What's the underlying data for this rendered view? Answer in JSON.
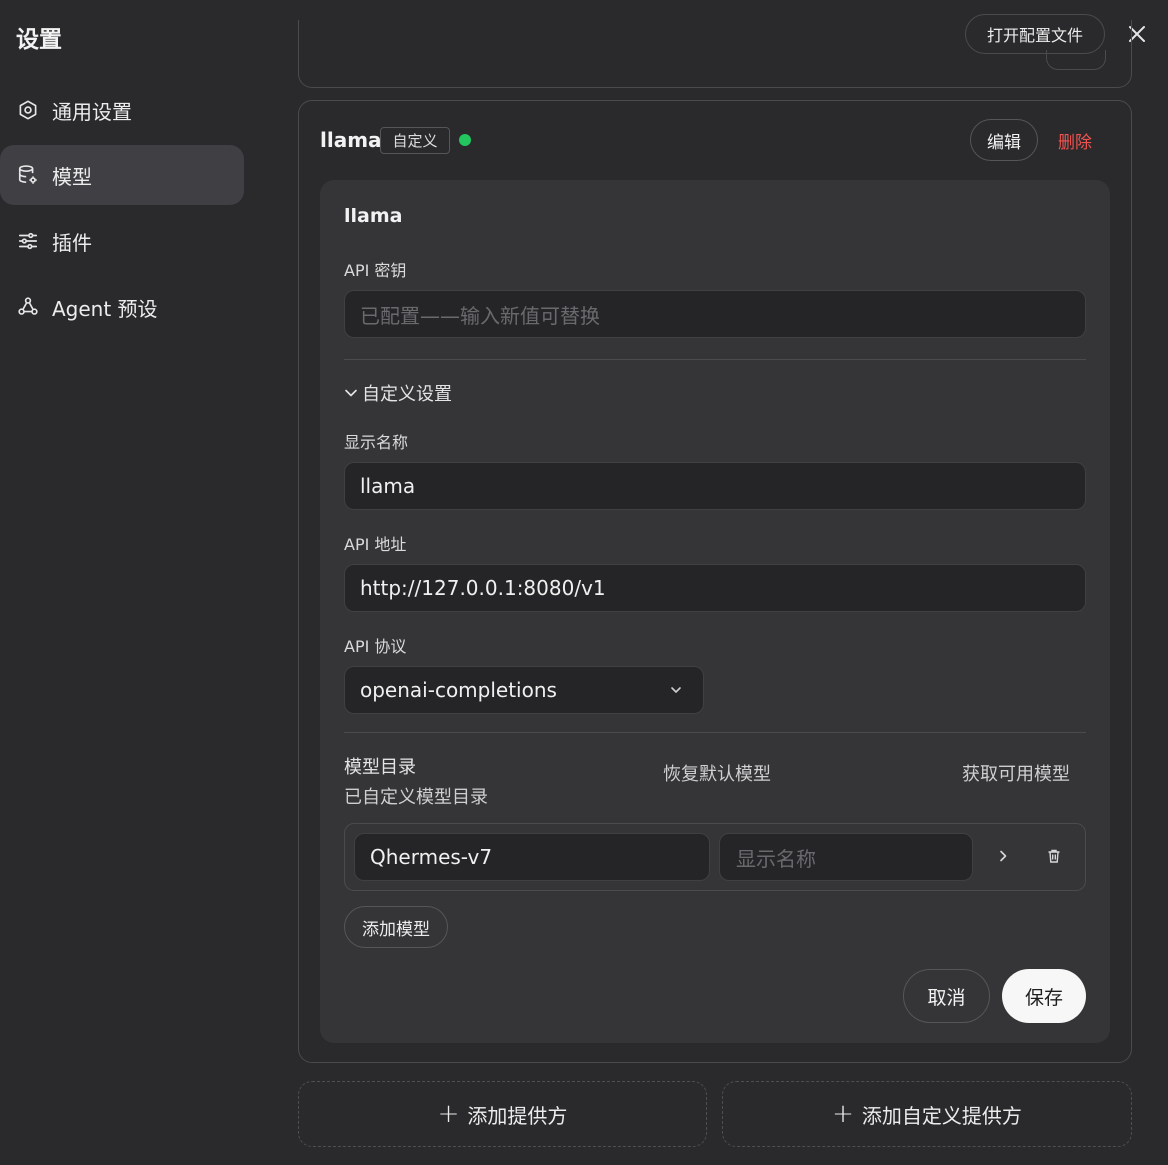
{
  "header": {
    "title": "设置",
    "open_config_label": "打开配置文件",
    "close_icon": "close-icon"
  },
  "sidebar": {
    "items": [
      {
        "label": "通用设置",
        "icon": "gear-icon",
        "active": false
      },
      {
        "label": "模型",
        "icon": "database-gear-icon",
        "active": true
      },
      {
        "label": "插件",
        "icon": "sliders-icon",
        "active": false
      },
      {
        "label": "Agent 预设",
        "icon": "agent-nodes-icon",
        "active": false
      }
    ]
  },
  "provider": {
    "name": "llama",
    "badge": "自定义",
    "status_color": "#22c55e",
    "edit_label": "编辑",
    "delete_label": "删除",
    "delete_color": "#ef5350"
  },
  "form": {
    "title": "llama",
    "api_key_label": "API 密钥",
    "api_key_placeholder": "已配置——输入新值可替换",
    "custom_settings_label": "自定义设置",
    "display_name_label": "显示名称",
    "display_name_value": "llama",
    "api_url_label": "API 地址",
    "api_url_value": "http://127.0.0.1:8080/v1",
    "api_protocol_label": "API 协议",
    "api_protocol_value": "openai-completions",
    "catalog_title": "模型目录",
    "catalog_subtitle": "已自定义模型目录",
    "reset_models_label": "恢复默认模型",
    "fetch_models_label": "获取可用模型",
    "models": [
      {
        "id": "Qhermes-v7",
        "display_placeholder": "显示名称"
      }
    ],
    "add_model_label": "添加模型",
    "cancel_label": "取消",
    "save_label": "保存"
  },
  "footer": {
    "add_provider_label": "添加提供方",
    "add_custom_provider_label": "添加自定义提供方"
  }
}
